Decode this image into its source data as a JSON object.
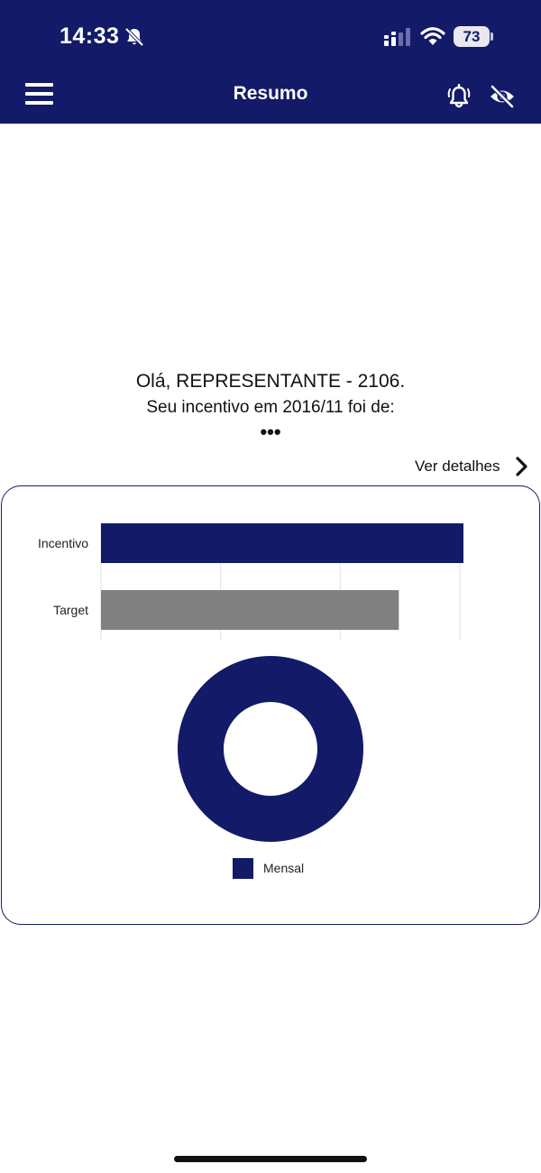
{
  "status_bar": {
    "time": "14:33",
    "battery_level": "73",
    "icons": [
      "bell-slash-icon",
      "cellular-signal-icon",
      "wifi-icon",
      "battery-icon"
    ]
  },
  "header": {
    "title": "Resumo",
    "icons": [
      "menu-icon",
      "bell-icon",
      "eye-slash-icon"
    ]
  },
  "main": {
    "greeting": "Olá, REPRESENTANTE - 2106.",
    "incentive_text": "Seu incentivo em 2016/11 foi de:",
    "incentive_value": "•••",
    "details_link": "Ver detalhes"
  },
  "colors": {
    "primary": "#131a68",
    "target_bar": "#808080"
  },
  "chart_data": [
    {
      "type": "bar",
      "orientation": "horizontal",
      "categories": [
        "Incentivo",
        "Target"
      ],
      "values": [
        1.01,
        0.83
      ],
      "xlim": [
        0,
        1
      ],
      "colors": [
        "#131a68",
        "#808080"
      ],
      "grid": true
    },
    {
      "type": "pie",
      "donut": true,
      "labels": [
        "Mensal"
      ],
      "values": [
        1
      ],
      "colors": [
        "#131a68"
      ],
      "legend": "bottom"
    }
  ]
}
